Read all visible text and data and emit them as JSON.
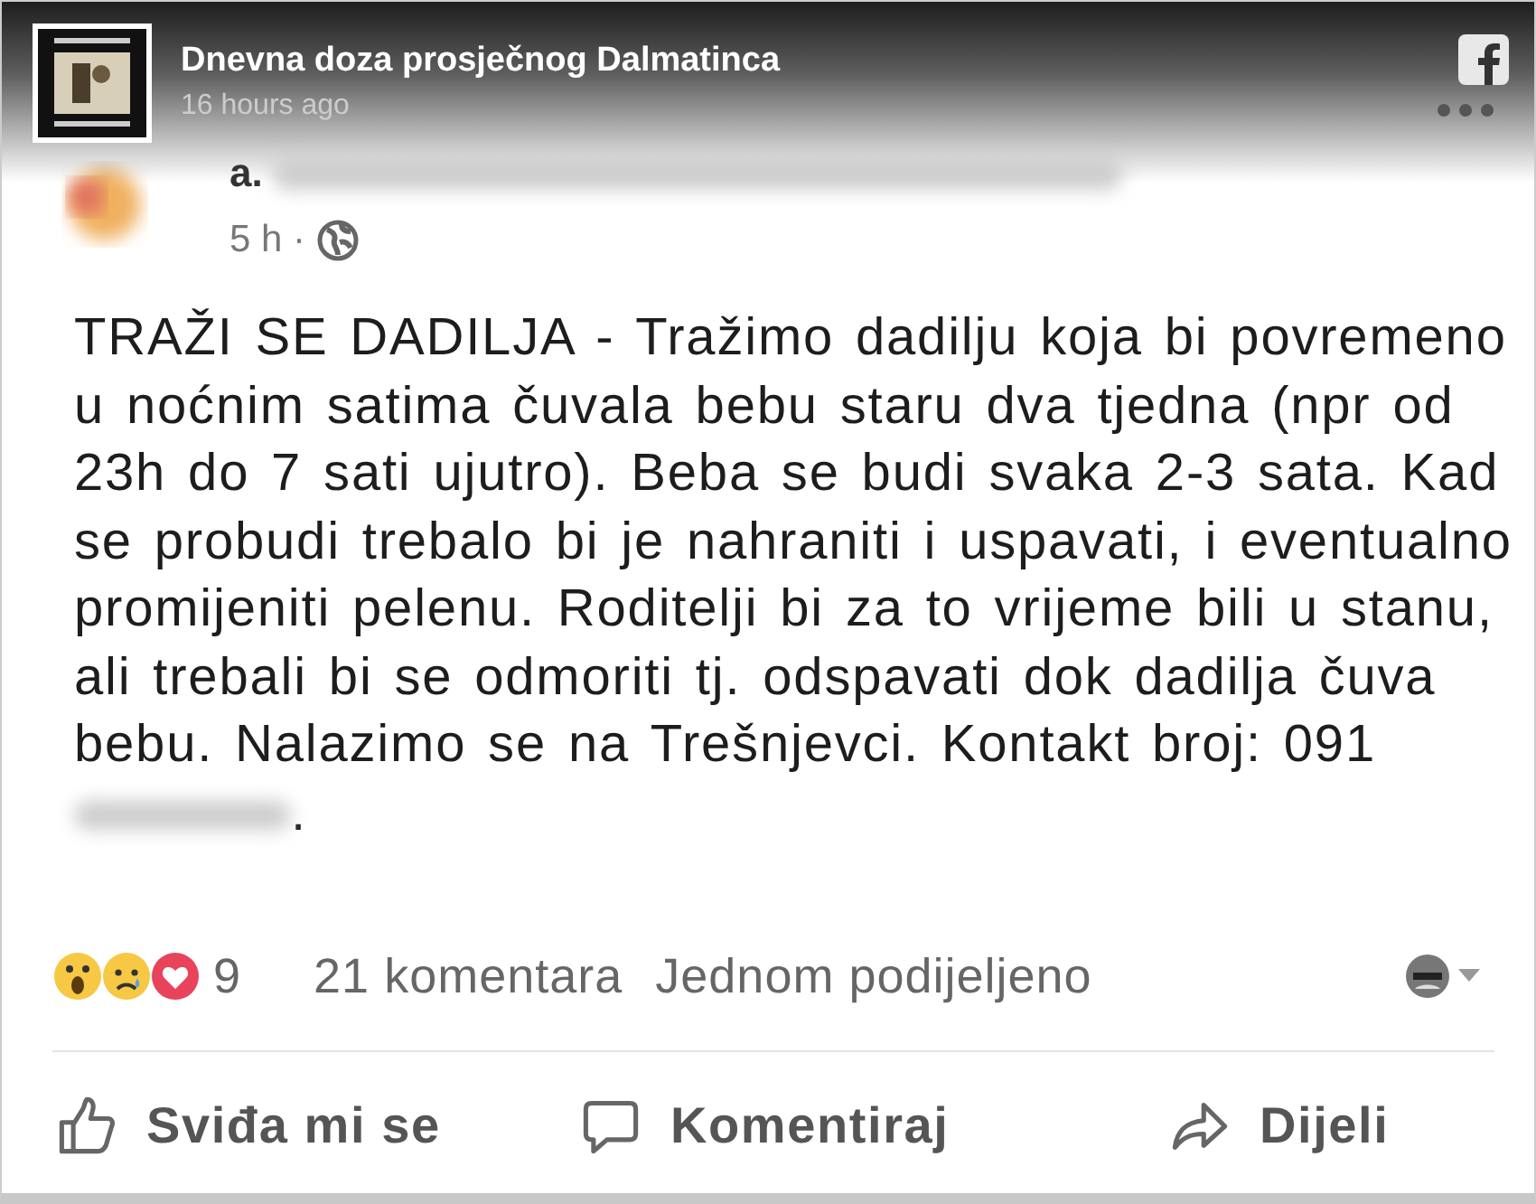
{
  "header": {
    "page_name": "Dnevna doza prosječnog Dalmatinca",
    "time": "16 hours ago"
  },
  "post": {
    "author_visible": "a.",
    "time": "5 h ·",
    "body": "TRAŽI SE DADILJA - Tražimo dadilju koja bi povremeno u noćnim satima čuvala bebu staru dva tjedna (npr od 23h do 7 sati ujutro). Beba se budi svaka 2-3 sata. Kad se probudi trebalo bi je nahraniti i uspavati, i eventualno promijeniti pelenu. Roditelji bi za to vrijeme bili u stanu, ali trebali bi se odmoriti tj. odspavati dok dadilja čuva bebu. Nalazimo se na Trešnjevci. Kontakt broj: 091",
    "body_end": "."
  },
  "stats": {
    "reactions": [
      {
        "kind": "wow"
      },
      {
        "kind": "sad"
      },
      {
        "kind": "love"
      }
    ],
    "reaction_count": "9",
    "comments": "21 komentara",
    "shares": "Jednom podijeljeno"
  },
  "actions": [
    {
      "kind": "like",
      "label": "Sviđa mi se"
    },
    {
      "kind": "comment",
      "label": "Komentiraj"
    },
    {
      "kind": "share",
      "label": "Dijeli"
    }
  ]
}
